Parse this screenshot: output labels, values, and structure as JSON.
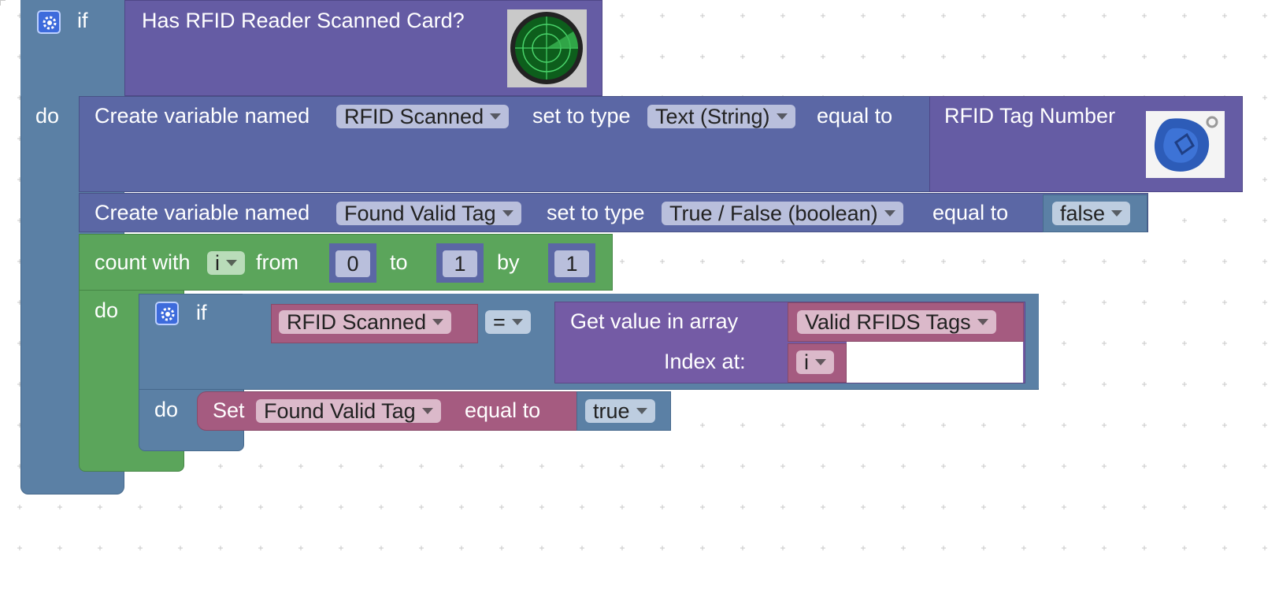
{
  "outer_if": {
    "if_label": "if",
    "do_label": "do",
    "condition": {
      "label": "Has RFID Reader Scanned Card?",
      "image_icon": "radar-scanner-icon"
    }
  },
  "create_var_1": {
    "prefix": "Create variable named",
    "var_name": "RFID Scanned",
    "set_type_label": "set to type",
    "type": "Text (String)",
    "equal_label": "equal to",
    "value": {
      "label": "RFID Tag Number",
      "image_icon": "rfid-keyfob-icon"
    }
  },
  "create_var_2": {
    "prefix": "Create variable named",
    "var_name": "Found Valid Tag",
    "set_type_label": "set to type",
    "type": "True / False (boolean)",
    "equal_label": "equal to",
    "value": "false"
  },
  "count_loop": {
    "prefix": "count with",
    "var": "i",
    "from_label": "from",
    "from_value": "0",
    "to_label": "to",
    "to_value": "1",
    "by_label": "by",
    "by_value": "1",
    "do_label": "do"
  },
  "inner_if": {
    "if_label": "if",
    "do_label": "do",
    "left": "RFID Scanned",
    "operator": "=",
    "array_get": {
      "label": "Get value in array",
      "array": "Valid RFIDS Tags",
      "index_label": "Index at:",
      "index": "i"
    }
  },
  "set_block": {
    "set_label": "Set",
    "var_name": "Found Valid Tag",
    "equal_label": "equal to",
    "value": "true"
  },
  "colors": {
    "logic": "#5b80a5",
    "event_purple": "#655ca4",
    "variables": "#5b67a5",
    "loops": "#5ba55b",
    "arrays": "#745ba5",
    "set_pink": "#a55b80"
  }
}
